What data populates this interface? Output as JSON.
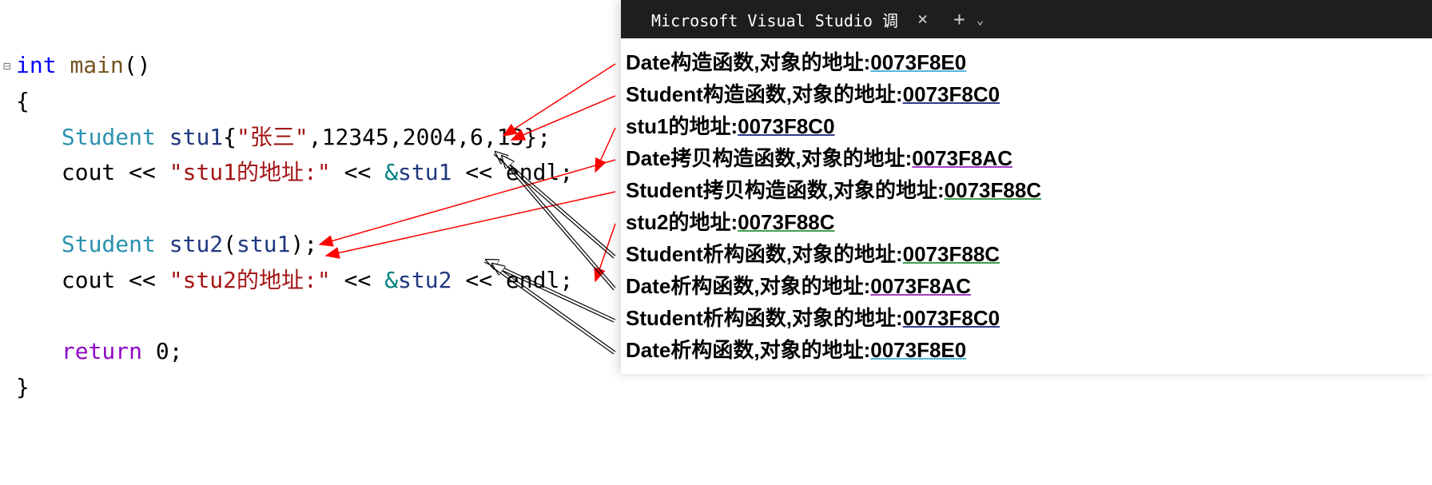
{
  "code": {
    "sig_int": "int",
    "sig_main": "main",
    "sig_paren": "()",
    "brace_open": "{",
    "brace_close": "}",
    "line1": {
      "type": "Student",
      "var": "stu1",
      "brace_l": "{",
      "str": "\"张三\"",
      "args": ",12345,2004,6,13",
      "brace_r": "};"
    },
    "line2": {
      "cout": "cout",
      "op1": " << ",
      "str": "\"stu1的地址:\"",
      "op2": " << ",
      "amp": "&",
      "var": "stu1",
      "op3": " << ",
      "endl": "endl",
      "semi": ";"
    },
    "line3": {
      "type": "Student",
      "var": "stu2",
      "paren_l": "(",
      "arg": "stu1",
      "paren_r": ");"
    },
    "line4": {
      "cout": "cout",
      "op1": " << ",
      "str": "\"stu2的地址:\"",
      "op2": " << ",
      "amp": "&",
      "var": "stu2",
      "op3": " << ",
      "endl": "endl",
      "semi": ";"
    },
    "return_kw": "return",
    "return_val": " 0;"
  },
  "debug": {
    "title": "Microsoft Visual Studio 调",
    "close": "×",
    "plus": "+",
    "chevron": "⌄",
    "lines": [
      {
        "text": "Date构造函数,对象的地址:",
        "addr": "0073F8E0",
        "ul": "ul-cyan"
      },
      {
        "text": "Student构造函数,对象的地址:",
        "addr": "0073F8C0",
        "ul": "ul-blue"
      },
      {
        "text": "stu1的地址:",
        "addr": "0073F8C0",
        "ul": "ul-blue"
      },
      {
        "text": "Date拷贝构造函数,对象的地址:",
        "addr": "0073F8AC",
        "ul": "ul-purple"
      },
      {
        "text": "Student拷贝构造函数,对象的地址:",
        "addr": "0073F88C",
        "ul": "ul-green"
      },
      {
        "text": "stu2的地址:",
        "addr": "0073F88C",
        "ul": "ul-green"
      },
      {
        "text": "Student析构函数,对象的地址:",
        "addr": "0073F88C",
        "ul": "ul-green"
      },
      {
        "text": "Date析构函数,对象的地址:",
        "addr": "0073F8AC",
        "ul": "ul-purple"
      },
      {
        "text": "Student析构函数,对象的地址:",
        "addr": "0073F8C0",
        "ul": "ul-blue"
      },
      {
        "text": "Date析构函数,对象的地址:",
        "addr": "0073F8E0",
        "ul": "ul-cyan"
      }
    ]
  }
}
